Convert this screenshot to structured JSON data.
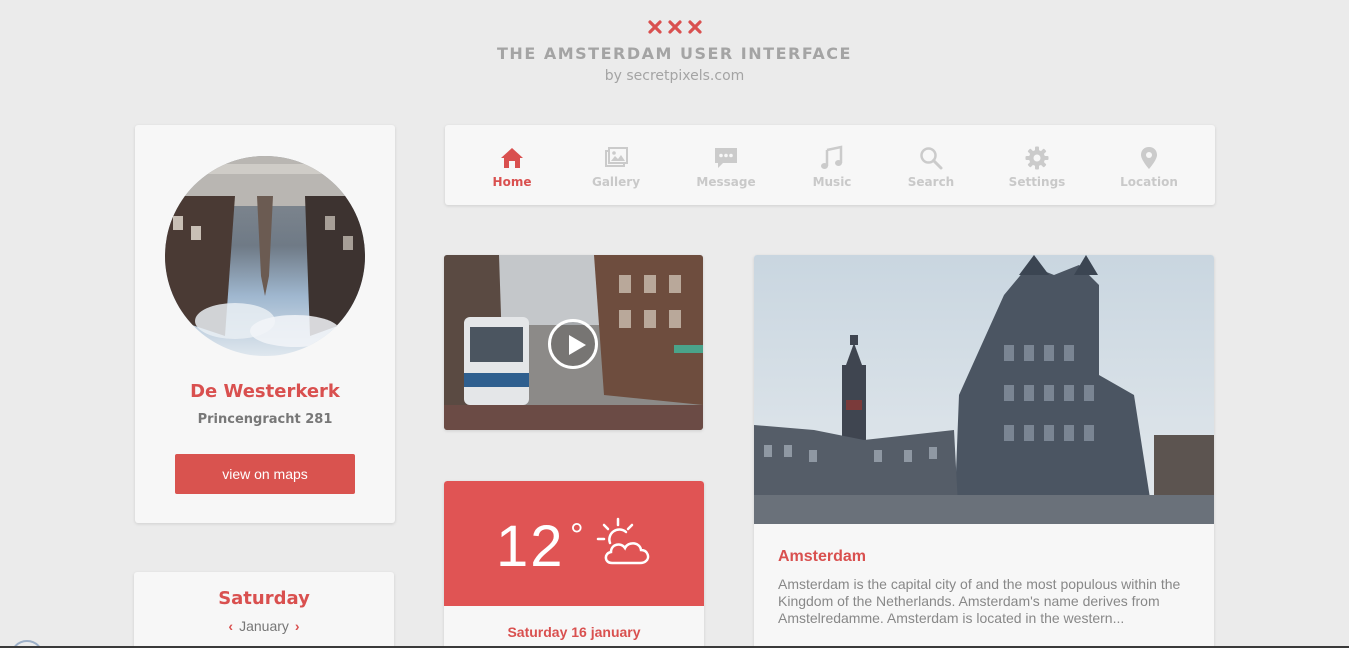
{
  "header": {
    "title": "THE AMSTERDAM USER INTERFACE",
    "subtitle": "by secretpixels.com",
    "logo_icon": "triple-x-icon",
    "accent": "#d9504f"
  },
  "profile": {
    "name": "De Westerkerk",
    "address": "Princengracht 281",
    "button_label": "view on maps"
  },
  "navigation": {
    "items": [
      {
        "label": "Home",
        "icon": "home-icon",
        "active": true
      },
      {
        "label": "Gallery",
        "icon": "gallery-icon",
        "active": false
      },
      {
        "label": "Message",
        "icon": "message-icon",
        "active": false
      },
      {
        "label": "Music",
        "icon": "music-icon",
        "active": false
      },
      {
        "label": "Search",
        "icon": "search-icon",
        "active": false
      },
      {
        "label": "Settings",
        "icon": "gear-icon",
        "active": false
      },
      {
        "label": "Location",
        "icon": "location-pin-icon",
        "active": false
      }
    ]
  },
  "video": {
    "play_icon": "play-icon"
  },
  "weather": {
    "temperature": "12",
    "degree": "°",
    "icon": "sun-cloud-icon",
    "date": "Saturday 16 january"
  },
  "calendar": {
    "day": "Saturday",
    "month": "January"
  },
  "article": {
    "title": "Amsterdam",
    "body": "Amsterdam is the capital city of and the most populous within the Kingdom of the Netherlands. Amsterdam's name derives from Amstelredamme. Amsterdam is located in the western..."
  }
}
